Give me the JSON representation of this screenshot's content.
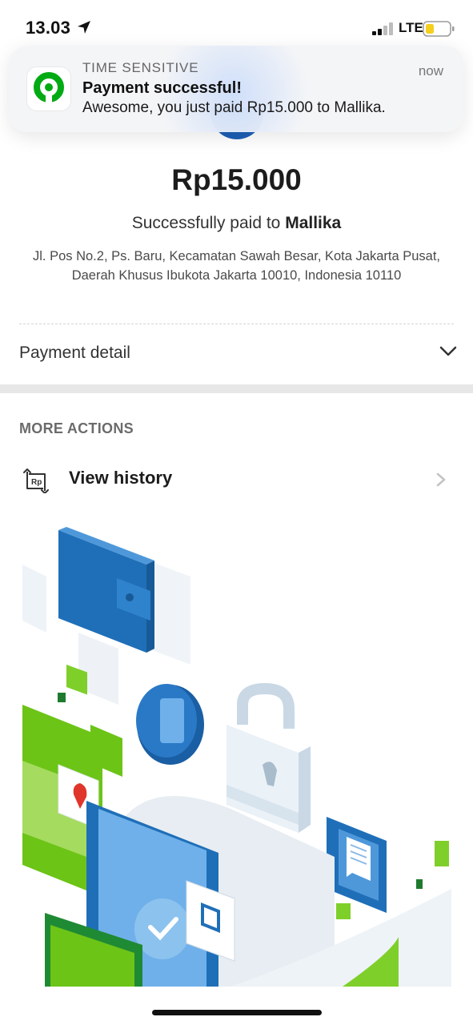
{
  "status_bar": {
    "time": "13.03",
    "network": "LTE",
    "icons": [
      "location-arrow-icon",
      "signal-icon",
      "battery-icon"
    ]
  },
  "notification": {
    "kicker": "TIME SENSITIVE",
    "title": "Payment successful!",
    "body": "Awesome, you just paid Rp15.000 to Mallika.",
    "time": "now",
    "app_icon": "gopay-app-icon",
    "brand_color": "#00aa13"
  },
  "summary": {
    "amount": "Rp15.000",
    "paid_prefix": "Successfully paid to",
    "merchant": "Mallika",
    "address": "Jl. Pos No.2, Ps. Baru, Kecamatan Sawah Besar, Kota Jakarta Pusat, Daerah Khusus Ibukota Jakarta 10010, Indonesia 10110"
  },
  "payment_detail": {
    "label": "Payment detail",
    "icon": "chevron-down-icon"
  },
  "more_actions": {
    "title": "MORE ACTIONS",
    "items": [
      {
        "label": "View history",
        "icon": "rp-history-icon",
        "trailing_icon": "chevron-right-icon"
      }
    ]
  },
  "colors": {
    "accent_blue": "#1d5fb5",
    "accent_green": "#6cc417",
    "text_primary": "#1c1c1c",
    "divider": "#e7e7e7"
  }
}
